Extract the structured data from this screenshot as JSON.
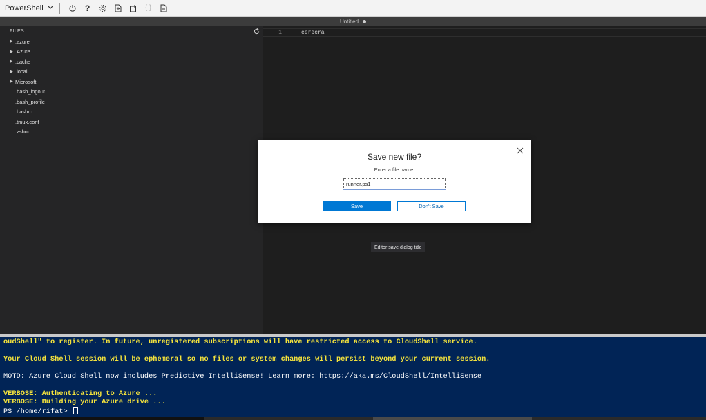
{
  "toolbar": {
    "shell_label": "PowerShell",
    "help_glyph": "?",
    "braces_glyph": "{ }",
    "icons": [
      "chevron-down-icon",
      "power-icon",
      "help-icon",
      "settings-icon",
      "upload-icon",
      "new-window-icon",
      "braces-icon",
      "file-share-icon"
    ]
  },
  "editor": {
    "tab_title": "Untitled",
    "line_number": "1",
    "line_text": "eereera"
  },
  "explorer": {
    "header": "FILES",
    "folders": [
      ".azure",
      ".Azure",
      ".cache",
      ".local",
      "Microsoft"
    ],
    "files": [
      ".bash_logout",
      ".bash_profile",
      ".bashrc",
      ".tmux.conf",
      ".zshrc"
    ]
  },
  "dialog": {
    "title": "Save new file?",
    "subtitle": "Enter a file name.",
    "input_value": "runner.ps1",
    "save_label": "Save",
    "dont_save_label": "Don't Save"
  },
  "tooltip": "Editor save dialog title",
  "terminal": {
    "line1": "oudShell\" to register. In future, unregistered subscriptions will have restricted access to CloudShell service.",
    "line2": "Your Cloud Shell session will be ephemeral so no files or system changes will persist beyond your current session.",
    "line3": "MOTD: Azure Cloud Shell now includes Predictive IntelliSense! Learn more: https://aka.ms/CloudShell/IntelliSense",
    "line4": "VERBOSE: Authenticating to Azure ...",
    "line5": "VERBOSE: Building your Azure drive ...",
    "prompt": "PS /home/rifat> "
  },
  "colors": {
    "terminal_bg": "#012456",
    "terminal_yellow": "#f5e33c",
    "accent": "#0078d4"
  }
}
